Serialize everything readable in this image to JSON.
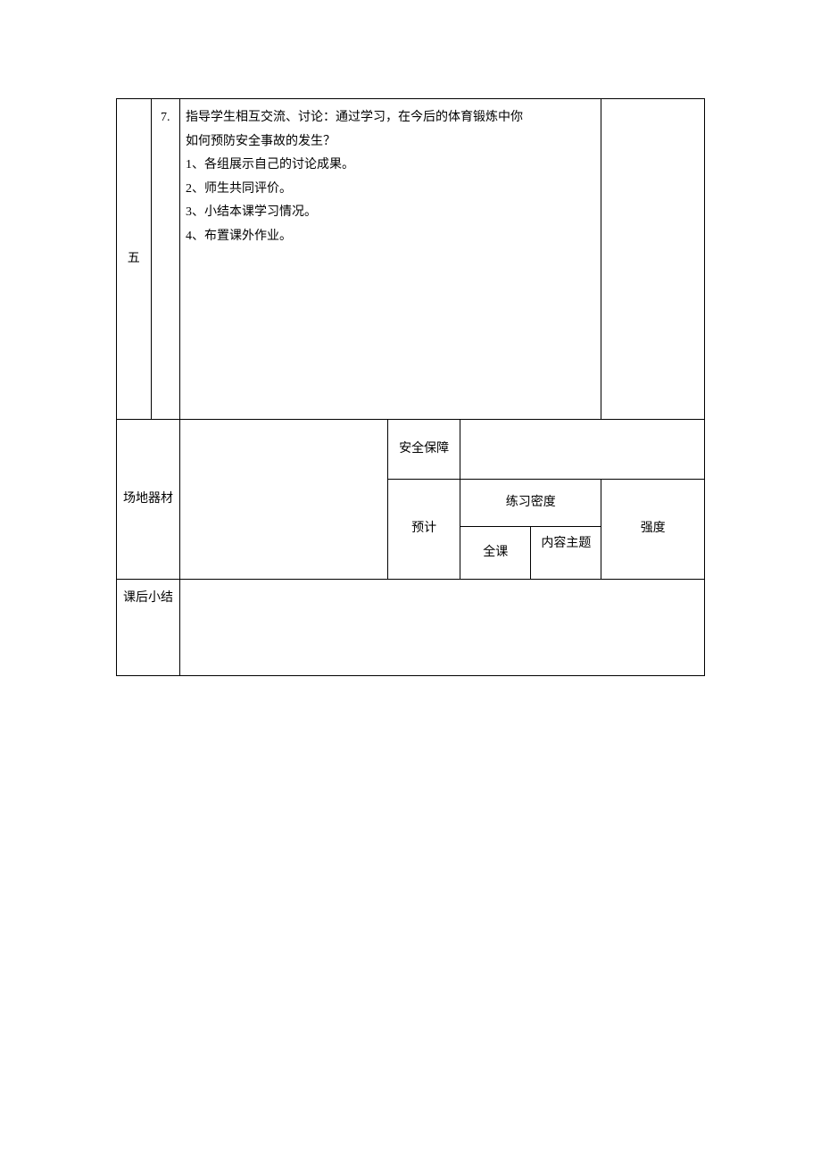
{
  "row1": {
    "col1": "五",
    "col2": "7.",
    "content_line1": "指导学生相互交流、讨论：通过学习，在今后的体育锻炼中你",
    "content_line2": "如何预防安全事故的发生？",
    "content_line3": "1、各组展示自己的讨论成果。",
    "content_line4": "2、师生共同评价。",
    "content_line5": "3、小结本课学习情况。",
    "content_line6": "4、布置课外作业。"
  },
  "section2": {
    "left_label": "场地器材",
    "safety": "安全保障",
    "forecast": "预计",
    "practice_density": "练习密度",
    "intensity": "强度",
    "full_class": "全课",
    "content_topic": "内容主题"
  },
  "section3": {
    "label": "课后小结"
  }
}
